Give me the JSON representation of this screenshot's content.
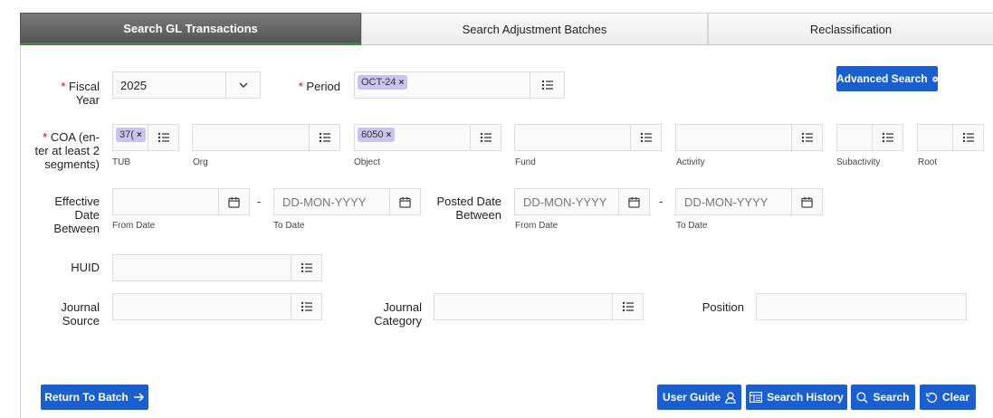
{
  "tabs": [
    {
      "label": "Search GL Transactions",
      "active": true
    },
    {
      "label": "Search Adjustment Batches",
      "active": false
    },
    {
      "label": "Reclassification",
      "active": false
    }
  ],
  "fiscal_year": {
    "required_mark": "*",
    "label_line1": "Fiscal",
    "label_line2": "Year",
    "value": "2025"
  },
  "period": {
    "required_mark": "*",
    "label": "Period",
    "chip": "OCT-24"
  },
  "advanced_search_label": "Advanced Search",
  "coa": {
    "required_mark": "*",
    "label_line1": "COA (en-",
    "label_line2": "ter at least 2",
    "label_line3": "segments)",
    "segments": [
      {
        "label": "TUB",
        "chip": "37("
      },
      {
        "label": "Org",
        "chip": ""
      },
      {
        "label": "Object",
        "chip": "6050"
      },
      {
        "label": "Fund",
        "chip": ""
      },
      {
        "label": "Activity",
        "chip": ""
      },
      {
        "label": "Subactivity",
        "chip": ""
      },
      {
        "label": "Root",
        "chip": ""
      }
    ]
  },
  "effective_date": {
    "label_line1": "Effective",
    "label_line2": "Date",
    "label_line3": "Between",
    "from_label": "From Date",
    "to_label": "To Date",
    "from_placeholder": "",
    "to_placeholder": "DD-MON-YYYY"
  },
  "posted_date": {
    "label_line1": "Posted Date",
    "label_line2": "Between",
    "from_label": "From Date",
    "to_label": "To Date",
    "from_placeholder": "DD-MON-YYYY",
    "to_placeholder": "DD-MON-YYYY"
  },
  "range_separator": "-",
  "chip_remove": "×",
  "huid": {
    "label": "HUID"
  },
  "journal_source": {
    "label_line1": "Journal",
    "label_line2": "Source"
  },
  "journal_category": {
    "label_line1": "Journal",
    "label_line2": "Category"
  },
  "position": {
    "label": "Position"
  },
  "buttons": {
    "return_to_batch": "Return To Batch",
    "user_guide": "User Guide",
    "search_history": "Search History",
    "search": "Search",
    "clear": "Clear"
  },
  "colors": {
    "primary_button": "#1a5fd0",
    "chip": "#c9c3ee",
    "required": "#d0021b",
    "active_tab": "#555555"
  }
}
